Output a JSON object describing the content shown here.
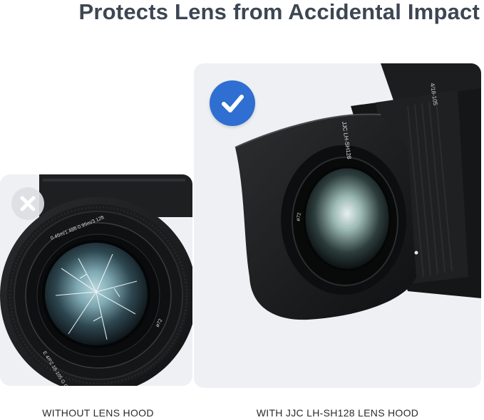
{
  "headline": "Protects Lens from Accidental Impact",
  "left_panel": {
    "caption": "WITHOUT LENS HOOD",
    "badge_icon": "x-icon",
    "lens_ring_text": "0.45m/1.48ft-0.95m/3.12ft",
    "lens_model_text": "E 4/PZ 18-105 G OSS",
    "filter_text": "ø72"
  },
  "right_panel": {
    "caption": "WITH JJC LH-SH128 LENS HOOD",
    "badge_icon": "checkmark-icon",
    "hood_brand_text": "JJC LH-SH128",
    "lens_barrel_text": "4/18-105",
    "filter_text": "ø72"
  },
  "colors": {
    "headline": "#3d4653",
    "panel_bg": "#eef0f3",
    "check_badge": "#2f6fd1",
    "x_badge": "#dcdee2",
    "caption": "#2a2a2a"
  }
}
